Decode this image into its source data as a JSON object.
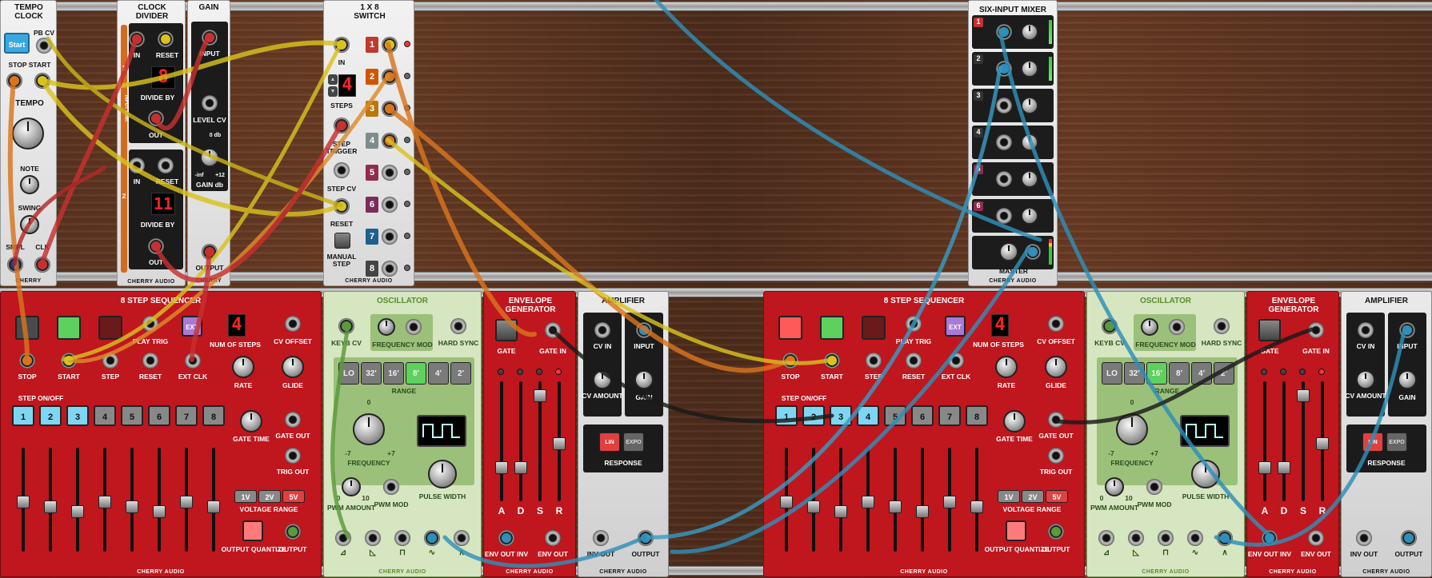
{
  "brand": "CHERRY AUDIO",
  "tempo_clock": {
    "title": "TEMPO CLOCK",
    "start": "Start",
    "pb_cv": "PB CV",
    "stop": "STOP",
    "start_jack": "START",
    "tempo": "TEMPO",
    "note": "NOTE",
    "swing": "SWING",
    "smpl": "SMPL",
    "clk": "CLK",
    "brand": "CHERRY"
  },
  "clock_divider": {
    "title": "CLOCK DIVIDER",
    "in": "IN",
    "reset": "RESET",
    "divide_by": "DIVIDE BY",
    "out": "OUT",
    "ch1_value": "8",
    "ch2_value": "11",
    "ch1": "1",
    "ch2": "2",
    "link": "INPUT LINK",
    "brand": "CHERRY AUDIO"
  },
  "gain": {
    "title": "GAIN",
    "input": "INPUT",
    "level_cv": "LEVEL CV",
    "zero_db": "0 db",
    "minus_inf": "-inf",
    "plus12": "+12",
    "gain_db": "GAIN db",
    "output": "OUTPUT",
    "brand": "CHERRY"
  },
  "switch": {
    "title": "1 X 8 SWITCH",
    "in": "IN",
    "steps": "STEPS",
    "steps_value": "4",
    "step_trigger": "STEP TRIGGER",
    "step_cv": "STEP CV",
    "reset": "RESET",
    "manual_step": "MANUAL STEP",
    "outputs": [
      "1",
      "2",
      "3",
      "4",
      "5",
      "6",
      "7",
      "8"
    ],
    "output_colors": [
      "#c0392b",
      "#d35400",
      "#b9770e",
      "#7f8c8d",
      "#8e2d4e",
      "#7b2d5a",
      "#1f5f8b",
      "#444"
    ],
    "brand": "CHERRY AUDIO"
  },
  "mixer": {
    "title": "SIX-INPUT MIXER",
    "channels": [
      "1",
      "2",
      "3",
      "4",
      "5",
      "6"
    ],
    "master": "MASTER",
    "brand": "CHERRY AUDIO"
  },
  "sequencer": {
    "title": "8 STEP SEQUENCER",
    "play_trig": "PLAY TRIG",
    "num_steps": "NUM OF STEPS",
    "num_steps_value": "4",
    "cv_offset": "CV OFFSET",
    "stop": "STOP",
    "start": "START",
    "step": "STEP",
    "reset": "RESET",
    "ext_clk": "EXT CLK",
    "ext": "EXT",
    "rate": "RATE",
    "glide": "GLIDE",
    "step_onoff": "STEP ON/OFF",
    "steps": [
      "1",
      "2",
      "3",
      "4",
      "5",
      "6",
      "7",
      "8"
    ],
    "gate_time": "GATE TIME",
    "gate_out": "GATE OUT",
    "trig_out": "TRIG OUT",
    "voltage_range": "VOLTAGE RANGE",
    "ranges": [
      "1V",
      "2V",
      "5V"
    ],
    "output_quantize": "OUTPUT QUANTIZE",
    "output": "OUTPUT",
    "brand": "CHERRY AUDIO"
  },
  "oscillator": {
    "title": "OSCILLATOR",
    "keyb_cv": "KEYB CV",
    "freq_mod": "FREQUENCY MOD",
    "hard_sync": "HARD SYNC",
    "ranges": [
      "LO",
      "32'",
      "16'",
      "8'",
      "4'",
      "2'"
    ],
    "range": "RANGE",
    "zero": "0",
    "minus7": "-7",
    "plus7": "+7",
    "frequency": "FREQUENCY",
    "pwm_amount": "PWM AMOUNT",
    "pwm_mod": "PWM MOD",
    "pulse_width": "PULSE WIDTH",
    "pw_zero": "0",
    "pw_ten": "10",
    "brand": "CHERRY AUDIO"
  },
  "envelope": {
    "title": "ENVELOPE GENERATOR",
    "gate": "GATE",
    "gate_in": "GATE IN",
    "sliders": [
      "A",
      "D",
      "S",
      "R"
    ],
    "env_out_inv": "ENV OUT INV",
    "env_out": "ENV OUT",
    "brand": "CHERRY AUDIO"
  },
  "amplifier": {
    "title": "AMPLIFIER",
    "cv_in": "CV IN",
    "input": "INPUT",
    "cv_amount": "CV AMOUNT",
    "gain": "GAIN",
    "lin": "LIN",
    "expo": "EXPO",
    "response": "RESPONSE",
    "inv_out": "INV OUT",
    "output": "OUTPUT",
    "brand": "CHERRY AUDIO"
  },
  "colors": {
    "cable_yellow": "#d9c21e",
    "cable_orange": "#d9751e",
    "cable_red": "#c83030",
    "cable_blue": "#2f8fb8",
    "cable_black": "#1a1a1a"
  }
}
